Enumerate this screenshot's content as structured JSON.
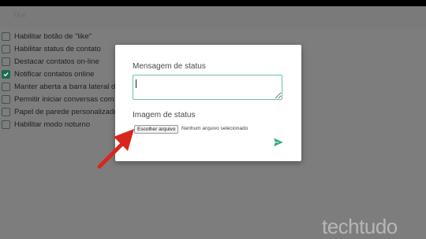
{
  "header": {
    "label": "Tkw"
  },
  "options": [
    {
      "label": "Habilitar botão de \"like\"",
      "checked": false
    },
    {
      "label": "Habilitar status de contato",
      "checked": false
    },
    {
      "label": "Destacar contatos on-line",
      "checked": false
    },
    {
      "label": "Notificar contatos online",
      "checked": true
    },
    {
      "label": "Manter aberta a barra lateral de",
      "checked": false
    },
    {
      "label": "Permitir iniciar conversas com",
      "checked": false
    },
    {
      "label": "Papel de parede personalizado",
      "checked": false
    },
    {
      "label": "Habilitar modo noturno",
      "checked": false
    }
  ],
  "modal": {
    "message_label": "Mensagem de status",
    "message_value": "",
    "image_label": "Imagem de status",
    "file_button_label": "Escolher arquivo",
    "file_status": "Nenhum arquivo selecionado",
    "send_icon": "send-icon"
  },
  "annotation": {
    "arrow_color": "#d9261c"
  },
  "watermark": {
    "text": "techtudo"
  },
  "colors": {
    "accent": "#2eaa83",
    "checkbox_checked": "#1e6b54",
    "overlay": "#7d7d7d"
  }
}
